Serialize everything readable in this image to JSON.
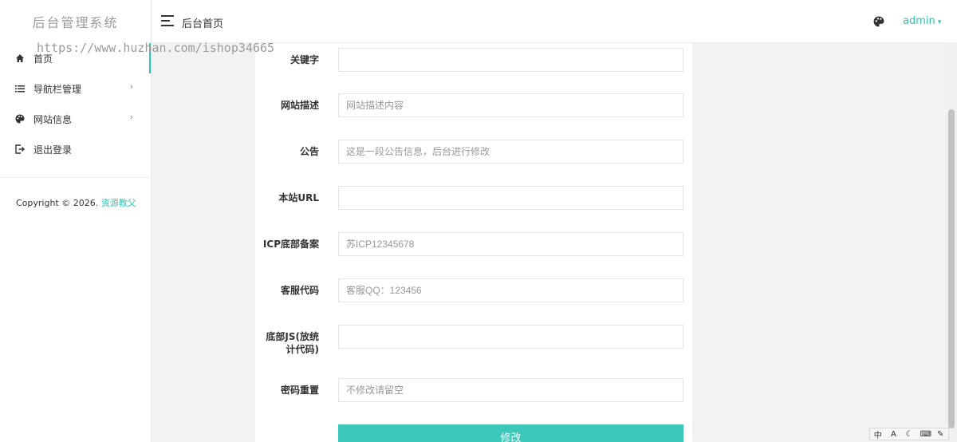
{
  "brand": "后台管理系统",
  "watermark": "https://www.huzhan.com/ishop34665",
  "sidebar": {
    "items": [
      {
        "label": "首页",
        "icon": "home-icon"
      },
      {
        "label": "导航栏管理",
        "icon": "list-icon",
        "chevron": "›"
      },
      {
        "label": "网站信息",
        "icon": "palette-icon",
        "chevron": "›"
      },
      {
        "label": "退出登录",
        "icon": "logout-icon"
      }
    ],
    "copyright_prefix": "Copyright © 2026.",
    "copyright_link": "资源教父"
  },
  "header": {
    "title": "后台首页",
    "user": "admin",
    "caret": "▾"
  },
  "form": {
    "fields": [
      {
        "label": "关键字",
        "value": "",
        "placeholder": ""
      },
      {
        "label": "网站描述",
        "value": "",
        "placeholder": "网站描述内容"
      },
      {
        "label": "公告",
        "value": "",
        "placeholder": "这是一段公告信息，后台进行修改"
      },
      {
        "label": "本站URL",
        "value": "",
        "placeholder": ""
      },
      {
        "label": "ICP底部备案",
        "value": "",
        "placeholder": "苏ICP12345678"
      },
      {
        "label": "客服代码",
        "value": "",
        "placeholder": "客服QQ：123456"
      },
      {
        "label": "底部JS(放统计代码)",
        "label_line1": "底部JS(放统",
        "label_line2": "计代码)",
        "value": "",
        "placeholder": ""
      },
      {
        "label": "密码重置",
        "value": "",
        "placeholder": "不修改请留空"
      }
    ],
    "submit_label": "修改"
  },
  "tray": {
    "items": [
      "中",
      "A",
      "☾",
      "⌨",
      "✎"
    ]
  },
  "colors": {
    "accent": "#2fc3b6",
    "button": "#3cc9b9"
  }
}
